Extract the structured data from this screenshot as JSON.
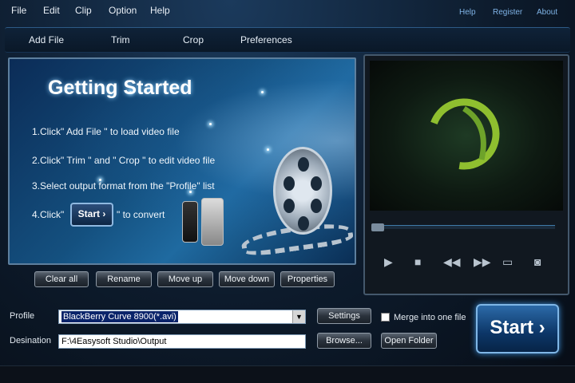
{
  "menu": [
    "File",
    "Edit",
    "Clip",
    "Option",
    "Help"
  ],
  "top_links": [
    "Help",
    "Register",
    "About"
  ],
  "toolbar": [
    "Add File",
    "Trim",
    "Crop",
    "Preferences"
  ],
  "getting_started": {
    "title": "Getting Started",
    "step1": "1.Click\" Add File \" to load video file",
    "step2": "2.Click\" Trim \" and \" Crop \" to edit video file",
    "step3": "3.Select output format from the \"Profile\" list",
    "step4_prefix": "4.Click\"",
    "step4_button": "Start",
    "step4_suffix": "\" to convert"
  },
  "actions": [
    "Clear all",
    "Rename",
    "Move up",
    "Move down",
    "Properties"
  ],
  "preview": {
    "seek_progress": 0.05,
    "controls": [
      "play-icon",
      "stop-icon",
      "rewind-icon",
      "forward-icon",
      "open-folder-icon",
      "snapshot-icon"
    ],
    "accent": "#3f94d8"
  },
  "profile": {
    "label": "Profile",
    "value": "BlackBerry Curve 8900(*.avi)",
    "settings_label": "Settings",
    "merge_label": "Merge into one file"
  },
  "destination": {
    "label": "Desination",
    "value": "F:\\4Easysoft Studio\\Output",
    "browse_label": "Browse...",
    "open_folder_label": "Open Folder"
  },
  "start_label": "Start"
}
